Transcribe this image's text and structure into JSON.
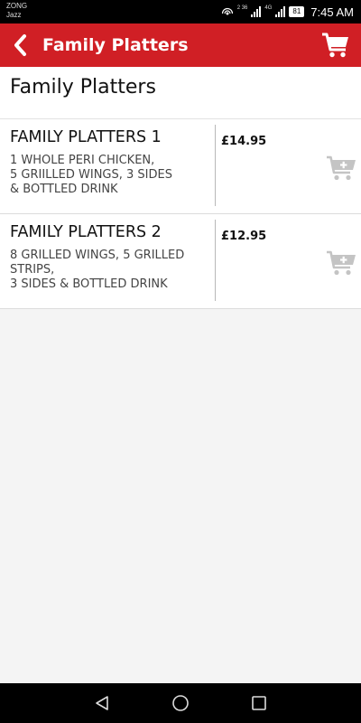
{
  "status_bar": {
    "carrier_1": "ZONG",
    "carrier_2": "Jazz",
    "signal_1_label": "2 36",
    "signal_2_label": "4G",
    "battery": "81",
    "time": "7:45 AM"
  },
  "app_bar": {
    "title": "Family Platters",
    "back_icon": "chevron-left-icon",
    "cart_icon": "shopping-cart-icon"
  },
  "page": {
    "title": "Family Platters"
  },
  "products": [
    {
      "name": "FAMILY PLATTERS 1",
      "description": "1 WHOLE PERI CHICKEN,\n5 GRIILLED WINGS, 3 SIDES\n& BOTTLED DRINK",
      "price": "£14.95"
    },
    {
      "name": "FAMILY PLATTERS 2",
      "description": "8 GRILLED WINGS, 5 GRILLED\nSTRIPS,\n3 SIDES & BOTTLED DRINK",
      "price": "£12.95"
    }
  ],
  "colors": {
    "brand_red": "#d01f25",
    "page_bg": "#f4f4f4",
    "add_icon": "#c4c4c4"
  },
  "nav_bar": {
    "back_icon": "triangle-back-icon",
    "home_icon": "circle-home-icon",
    "recents_icon": "square-recents-icon"
  }
}
